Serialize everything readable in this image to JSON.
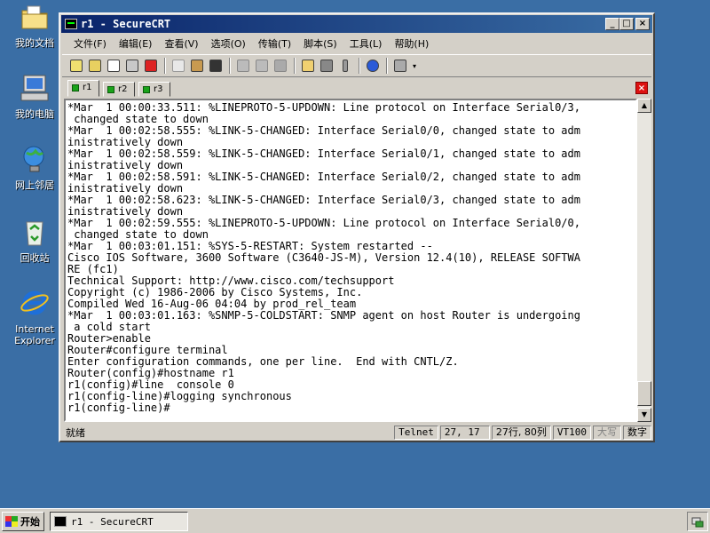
{
  "desktop": {
    "icons": [
      {
        "label": "我的文档",
        "icon": "folder-documents-icon"
      },
      {
        "label": "我的电脑",
        "icon": "computer-icon"
      },
      {
        "label": "网上邻居",
        "icon": "network-icon"
      },
      {
        "label": "回收站",
        "icon": "recycle-bin-icon"
      },
      {
        "label": "Internet Explorer",
        "icon": "internet-explorer-icon"
      }
    ]
  },
  "window": {
    "title": "r1 - SecureCRT",
    "controls": {
      "minimize": "_",
      "maximize": "□",
      "close": "×"
    }
  },
  "menu": [
    "文件(F)",
    "编辑(E)",
    "查看(V)",
    "选项(O)",
    "传输(T)",
    "脚本(S)",
    "工具(L)",
    "帮助(H)"
  ],
  "tabs": [
    {
      "label": "r1",
      "active": true
    },
    {
      "label": "r2",
      "active": false
    },
    {
      "label": "r3",
      "active": false
    }
  ],
  "terminal": {
    "lines": [
      "*Mar  1 00:00:33.511: %LINEPROTO-5-UPDOWN: Line protocol on Interface Serial0/3,",
      " changed state to down",
      "*Mar  1 00:02:58.555: %LINK-5-CHANGED: Interface Serial0/0, changed state to adm",
      "inistratively down",
      "*Mar  1 00:02:58.559: %LINK-5-CHANGED: Interface Serial0/1, changed state to adm",
      "inistratively down",
      "*Mar  1 00:02:58.591: %LINK-5-CHANGED: Interface Serial0/2, changed state to adm",
      "inistratively down",
      "*Mar  1 00:02:58.623: %LINK-5-CHANGED: Interface Serial0/3, changed state to adm",
      "inistratively down",
      "*Mar  1 00:02:59.555: %LINEPROTO-5-UPDOWN: Line protocol on Interface Serial0/0,",
      " changed state to down",
      "*Mar  1 00:03:01.151: %SYS-5-RESTART: System restarted --",
      "Cisco IOS Software, 3600 Software (C3640-JS-M), Version 12.4(10), RELEASE SOFTWA",
      "RE (fc1)",
      "Technical Support: http://www.cisco.com/techsupport",
      "Copyright (c) 1986-2006 by Cisco Systems, Inc.",
      "Compiled Wed 16-Aug-06 04:04 by prod_rel_team",
      "*Mar  1 00:03:01.163: %SNMP-5-COLDSTART: SNMP agent on host Router is undergoing",
      " a cold start",
      "Router>enable",
      "Router#configure terminal",
      "Enter configuration commands, one per line.  End with CNTL/Z.",
      "Router(config)#hostname r1",
      "r1(config)#line  console 0",
      "r1(config-line)#logging synchronous",
      "r1(config-line)#"
    ]
  },
  "status": {
    "ready": "就绪",
    "protocol": "Telnet",
    "cursor": "27,  17",
    "size": "27行, 80列",
    "emulation": "VT100",
    "caps": "大写",
    "num": "数字"
  },
  "taskbar": {
    "start": "开始",
    "task": "r1 - SecureCRT"
  }
}
